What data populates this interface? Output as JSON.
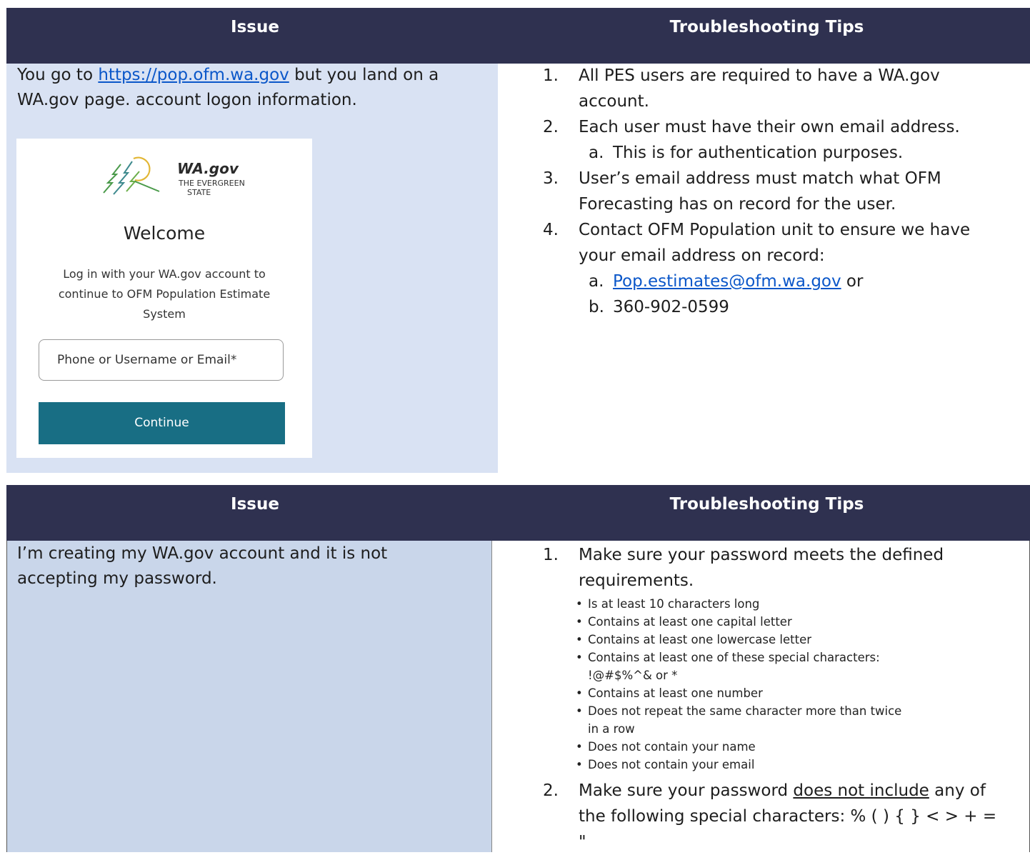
{
  "table1": {
    "header": {
      "issue": "Issue",
      "tips": "Troubleshooting Tips"
    },
    "issue": {
      "prefix": "You go to ",
      "link": "https://pop.ofm.wa.gov",
      "suffix_line1": " but you land on a",
      "line2": "WA.gov page. account logon information."
    },
    "tips": [
      {
        "num": "1.",
        "text": "All PES users are required to have a WA.gov account."
      },
      {
        "num": "2.",
        "text": "Each user must have their own email address."
      },
      {
        "num": "a.",
        "text": "This is for authentication purposes."
      },
      {
        "num": "3.",
        "text": "User’s email address must match what OFM Forecasting has on record for the user."
      },
      {
        "num": "4.",
        "text": "Contact OFM Population unit to ensure we have your email address on record:"
      },
      {
        "num": "a.",
        "link": "Pop.estimates@ofm.wa.gov",
        "suffix": " or"
      },
      {
        "num": "b.",
        "text": "360-902-0599"
      }
    ]
  },
  "login_card": {
    "brand_title": "WA.gov",
    "brand_sub_1": "THE EVERGREEN",
    "brand_sub_2": "STATE",
    "welcome": "Welcome",
    "description": "Log in with your WA.gov account to continue to OFM Population Estimate System",
    "field_placeholder": "Phone or Username or Email*",
    "button": "Continue"
  },
  "table2": {
    "header": {
      "issue": "Issue",
      "tips": "Troubleshooting Tips"
    },
    "issue_line1": "I’m creating my WA.gov account and it is not",
    "issue_line2": "accepting my password.",
    "tip1": {
      "num": "1.",
      "text": "Make sure your password meets the defined requirements."
    },
    "requirements": [
      "Is at least 10 characters long",
      "Contains at least one capital letter",
      "Contains at least one lowercase letter",
      "Contains at least one of these special characters: !@#$%^& or *",
      "Contains at least one number",
      "Does not repeat the same character more than twice in a row",
      "Does not contain your name",
      "Does not contain your email"
    ],
    "tip2": {
      "num": "2.",
      "prefix": "Make sure your password ",
      "underline": "does not include",
      "suffix": " any of the following special characters: % ( ) { } < > + = \""
    }
  }
}
